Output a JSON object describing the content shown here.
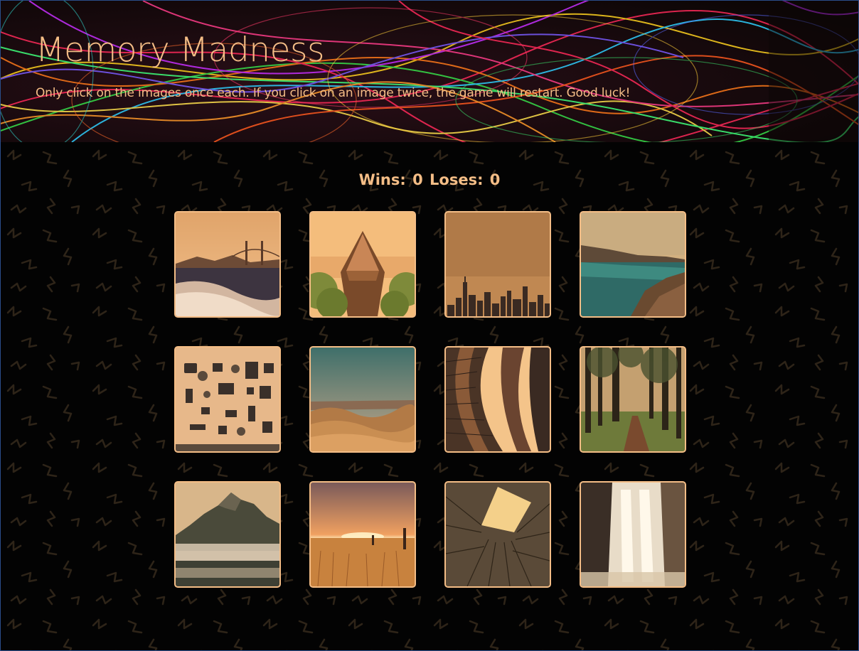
{
  "header": {
    "title": "Memory Madness",
    "subtitle": "Only click on the images once each. If you click on an image twice, the game will restart. Good luck!"
  },
  "score": {
    "wins_label": "Wins:",
    "wins": "0",
    "loses_label": "Loses:",
    "loses": "0"
  },
  "cards": [
    {
      "name": "golden-gate-beach-image",
      "subject": "beach with Golden Gate Bridge"
    },
    {
      "name": "canoe-bow-image",
      "subject": "canoe bow on a lake"
    },
    {
      "name": "city-skyline-image",
      "subject": "city skyline"
    },
    {
      "name": "rocky-coast-image",
      "subject": "rocky coastline with turquoise water"
    },
    {
      "name": "flatlay-gadgets-image",
      "subject": "flat-lay of cameras and gadgets"
    },
    {
      "name": "desert-hills-image",
      "subject": "desert hills landscape"
    },
    {
      "name": "library-shelves-image",
      "subject": "curved library bookshelves"
    },
    {
      "name": "forest-path-image",
      "subject": "forest path"
    },
    {
      "name": "mountain-fog-image",
      "subject": "mountain above fog"
    },
    {
      "name": "sunset-field-image",
      "subject": "sunset over a grass field"
    },
    {
      "name": "building-courtyard-image",
      "subject": "looking up a building courtyard"
    },
    {
      "name": "waterfall-image",
      "subject": "waterfall"
    }
  ],
  "colors": {
    "accent": "#f4bd86",
    "background": "#030303",
    "header_background": "#120808"
  }
}
